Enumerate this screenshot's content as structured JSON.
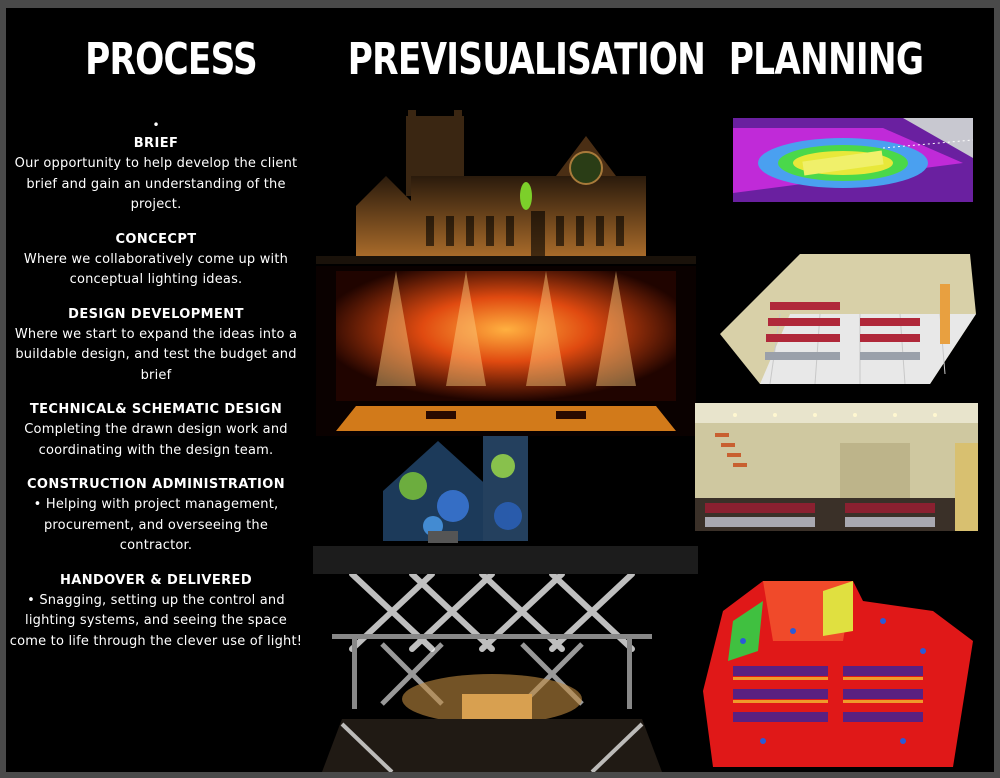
{
  "headings": {
    "process": "PROCESS",
    "previsualisation": "PREVISUALISATION",
    "planning": "PLANNING"
  },
  "process": {
    "bullet": "•",
    "steps": [
      {
        "title": "BRIEF",
        "description": "Our opportunity to help develop the client brief and gain an understanding of the project."
      },
      {
        "title": "CONCECPT",
        "description": "Where we collaboratively come up with conceptual lighting ideas."
      },
      {
        "title": "DESIGN DEVELOPMENT",
        "description": "Where we start to expand the ideas into a buildable design, and test the budget and brief"
      },
      {
        "title": "TECHNICAL& SCHEMATIC DESIGN",
        "description": "Completing the drawn design work and coordinating with the design team."
      },
      {
        "title": "CONSTRUCTION ADMINISTRATION",
        "description": "• Helping with project management, procurement, and overseeing the contractor."
      },
      {
        "title": "HANDOVER & DELIVERED",
        "description": "• Snagging, setting up the control and lighting systems, and seeing the space come to life through the clever use of light!"
      }
    ]
  },
  "colors": {
    "background": "#000000",
    "frame": "#4a4a4a",
    "text": "#ffffff"
  }
}
